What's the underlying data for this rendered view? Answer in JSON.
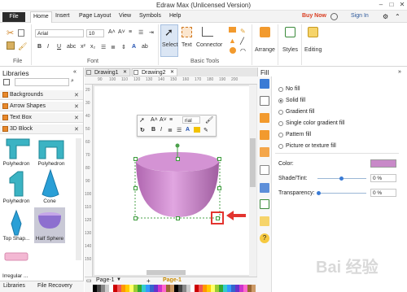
{
  "window": {
    "title": "Edraw Max (Unlicensed Version)",
    "min": "–",
    "max": "□",
    "close": "✕"
  },
  "menu": {
    "file": "File",
    "items": [
      "Home",
      "Insert",
      "Page Layout",
      "View",
      "Symbols",
      "Help"
    ],
    "buy_now": "Buy Now",
    "sign_in": "Sign In"
  },
  "ribbon": {
    "font_name": "Arial",
    "font_size": "10",
    "font_group": "Font",
    "file_group": "File",
    "select": "Select",
    "text": "Text",
    "connector": "Connector",
    "basic_tools": "Basic Tools",
    "arrange": "Arrange",
    "styles": "Styles",
    "editing": "Editing"
  },
  "libraries": {
    "title": "Libraries",
    "categories": [
      "Backgrounds",
      "Arrow Shapes",
      "Text Box",
      "3D Block"
    ],
    "shapes": [
      "Polyhedron",
      "Polyhedron",
      "Polyhedron",
      "Cone",
      "Top Shap...",
      "Half Sphere"
    ],
    "irregular": "Irregular ...",
    "tabs": [
      "Libraries",
      "File Recovery"
    ]
  },
  "tabs": [
    "Drawing1",
    "Drawing2"
  ],
  "ruler": {
    "top": [
      "90",
      "100",
      "110",
      "120",
      "130",
      "140",
      "150",
      "160",
      "170",
      "180",
      "190",
      "200"
    ],
    "left": [
      "20",
      "30",
      "40",
      "50",
      "60",
      "70",
      "80",
      "90",
      "100",
      "110",
      "120",
      "130",
      "140",
      "150"
    ]
  },
  "floattb": {
    "font": "rial"
  },
  "pages": {
    "current": "Page-1",
    "tab": "Page-1",
    "add": "+"
  },
  "fill": {
    "title": "Fill",
    "options": [
      "No fill",
      "Solid fill",
      "Gradient fill",
      "Single color gradient fill",
      "Pattern fill",
      "Picture or texture fill"
    ],
    "selected_index": 1,
    "color_label": "Color:",
    "shade_label": "Shade/Tint:",
    "shade_value": "0 %",
    "transparency_label": "Transparency:",
    "transparency_value": "0 %",
    "color_value": "#c889c8"
  },
  "colors": {
    "accent": "#2b579a",
    "buy": "#d93b1e",
    "shape": "#c67ec6",
    "arrow": "#e3342f"
  },
  "watermark": "Bai 经验"
}
